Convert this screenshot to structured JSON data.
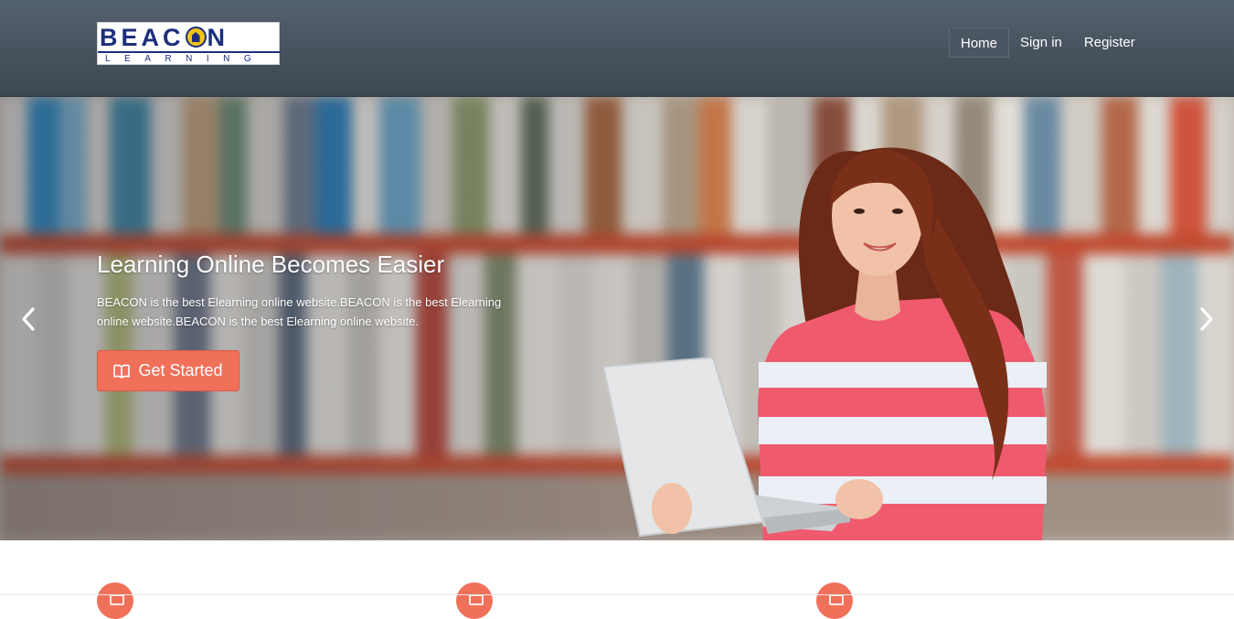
{
  "brand": {
    "logo_main": "BEACON",
    "logo_sub": "LEARNING",
    "colors": {
      "navy": "#1d2f7c",
      "gold": "#f0c419"
    }
  },
  "nav": {
    "items": [
      {
        "label": "Home",
        "active": true
      },
      {
        "label": "Sign in",
        "active": false
      },
      {
        "label": "Register",
        "active": false
      }
    ]
  },
  "hero": {
    "title": "Learning Online Becomes Easier",
    "text": "BEACON is the best Elearning online website.BEACON is the best Elearning online website.BEACON is the best Elearning online website.",
    "cta_label": "Get Started",
    "cta_icon": "book-open-icon",
    "prev_icon": "chevron-left-icon",
    "next_icon": "chevron-right-icon"
  },
  "features": {
    "icons": [
      "feature-icon",
      "feature-icon",
      "feature-icon"
    ],
    "accent": "#f0705a"
  },
  "colors": {
    "accent": "#f0705a",
    "header": "#4a5661",
    "text_on_dark": "#ffffff"
  }
}
